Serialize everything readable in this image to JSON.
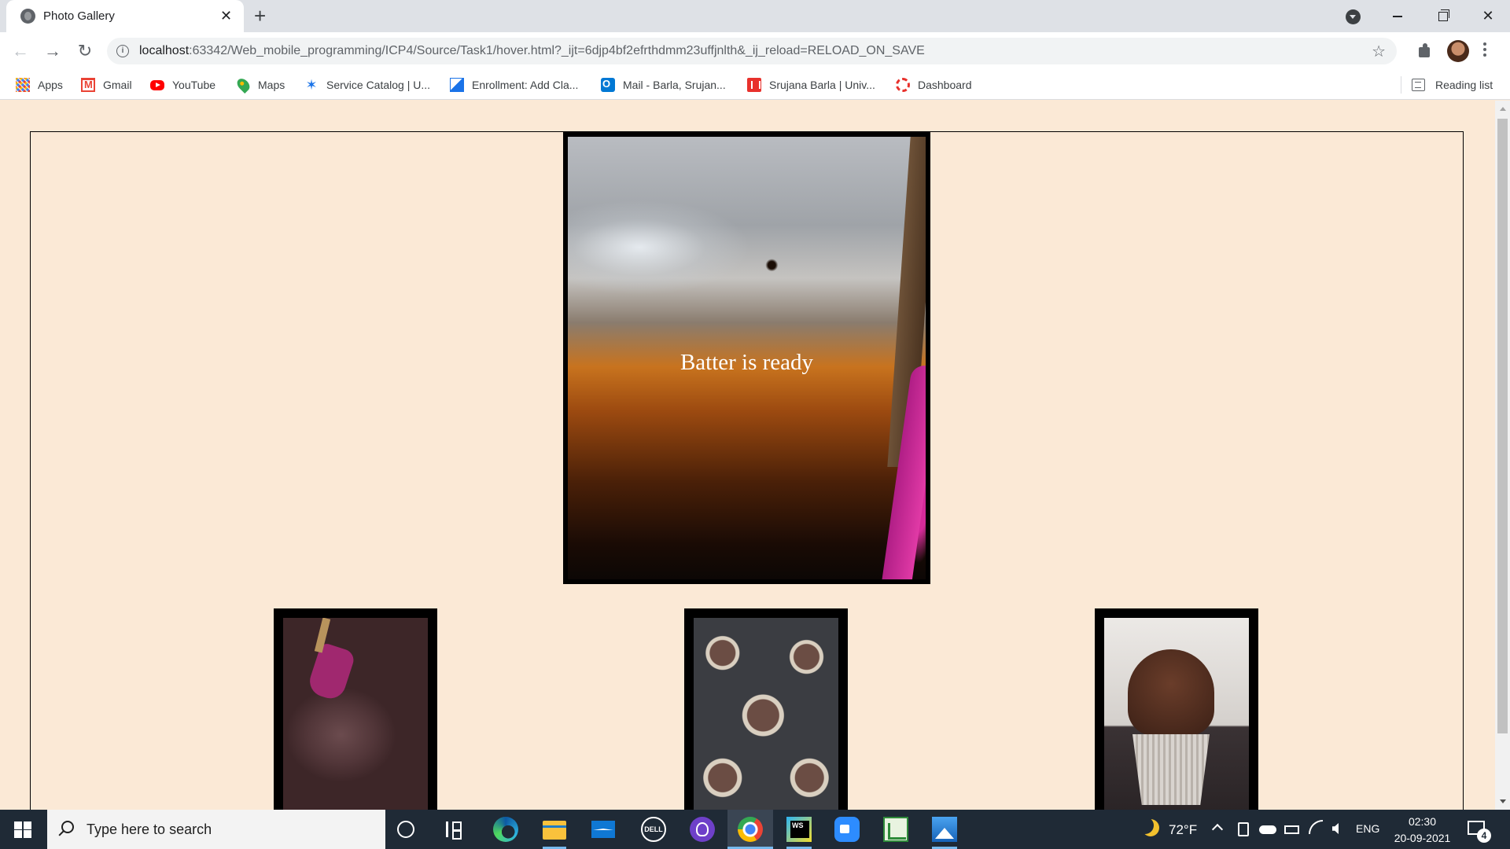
{
  "browser": {
    "tab_title": "Photo Gallery",
    "url_host": "localhost",
    "url_rest": ":63342/Web_mobile_programming/ICP4/Source/Task1/hover.html?_ijt=6djp4bf2efrthdmm23uffjnlth&_ij_reload=RELOAD_ON_SAVE",
    "bookmarks": [
      {
        "label": "Apps",
        "icon": "apps-grid-icon"
      },
      {
        "label": "Gmail",
        "icon": "gmail-icon"
      },
      {
        "label": "YouTube",
        "icon": "youtube-icon"
      },
      {
        "label": "Maps",
        "icon": "maps-pin-icon"
      },
      {
        "label": "Service Catalog | U...",
        "icon": "service-catalog-icon"
      },
      {
        "label": "Enrollment: Add Cla...",
        "icon": "enrollment-icon"
      },
      {
        "label": "Mail - Barla, Srujan...",
        "icon": "outlook-mail-icon"
      },
      {
        "label": "Srujana Barla | Univ...",
        "icon": "university-icon"
      },
      {
        "label": "Dashboard",
        "icon": "dashboard-icon"
      }
    ],
    "reading_list": "Reading list"
  },
  "gallery": {
    "hero_caption": "Batter is ready",
    "hero_image": "chocolate-batter-bowl-photo",
    "thumbnails": [
      {
        "name": "batter-with-spatula-photo"
      },
      {
        "name": "cupcake-tray-batter-photo"
      },
      {
        "name": "frosted-chocolate-cupcake-photo"
      }
    ]
  },
  "taskbar": {
    "search_placeholder": "Type here to search",
    "weather": "72°F",
    "language": "ENG",
    "time": "02:30",
    "date": "20-09-2021",
    "notification_count": "4"
  }
}
